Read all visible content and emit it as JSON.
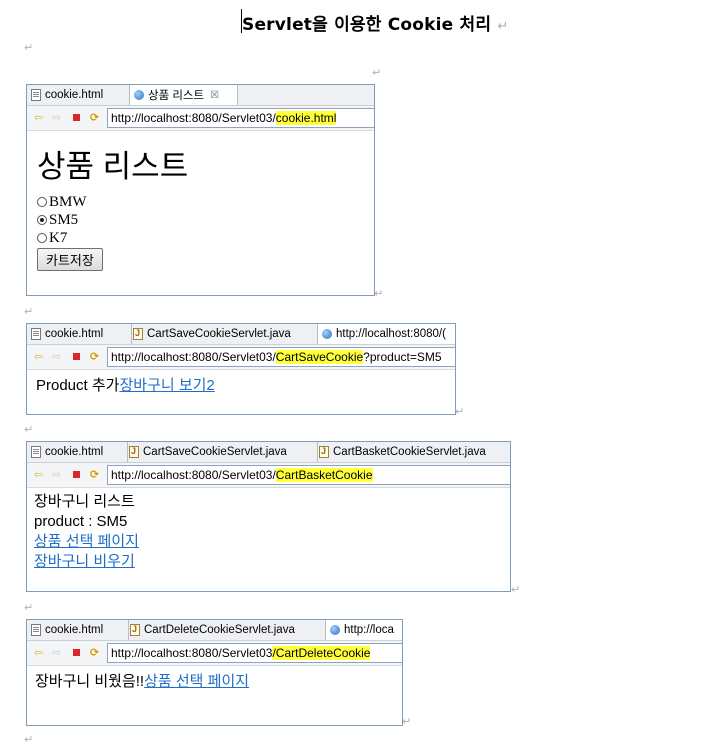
{
  "document": {
    "title": "Servlet을 이용한 Cookie 처리",
    "para_mark": "↵"
  },
  "panel1": {
    "tabs": [
      {
        "icon": "html-file-icon",
        "label": "cookie.html"
      },
      {
        "icon": "globe-icon",
        "label": "상품 리스트",
        "close": "☒"
      }
    ],
    "url_base": "http://localhost:8080/Servlet03/",
    "url_highlight": "cookie.html",
    "heading": "상품 리스트",
    "options": [
      {
        "label": "BMW",
        "checked": false
      },
      {
        "label": "SM5",
        "checked": true
      },
      {
        "label": "K7",
        "checked": false
      }
    ],
    "button": "카트저장"
  },
  "panel2": {
    "tabs": [
      {
        "icon": "html-file-icon",
        "label": "cookie.html"
      },
      {
        "icon": "java-file-icon",
        "label": "CartSaveCookieServlet.java"
      },
      {
        "icon": "globe-icon",
        "label": "http://localhost:8080/("
      }
    ],
    "url_base": "http://localhost:8080/Servlet03/",
    "url_highlight": "CartSaveCookie",
    "url_rest": "?product=SM5",
    "text": "Product 추가",
    "link": "장바구니 보기2"
  },
  "panel3": {
    "tabs": [
      {
        "icon": "html-file-icon",
        "label": "cookie.html"
      },
      {
        "icon": "java-file-icon",
        "label": "CartSaveCookieServlet.java"
      },
      {
        "icon": "java-file-icon",
        "label": "CartBasketCookieServlet.java"
      }
    ],
    "url_base": "http://localhost:8080/Servlet03/",
    "url_highlight": "CartBasketCookie",
    "line1": "장바구니 리스트",
    "line2": "product : SM5",
    "link1": "상품 선택 페이지",
    "link2": "장바구니 비우기"
  },
  "panel4": {
    "tabs": [
      {
        "icon": "html-file-icon",
        "label": "cookie.html"
      },
      {
        "icon": "java-file-icon",
        "label": "CartDeleteCookieServlet.java"
      },
      {
        "icon": "globe-icon",
        "label": "http://loca"
      }
    ],
    "url_base": "http://localhost:8080/Servlet03",
    "url_highlight": "/CartDeleteCookie",
    "text": "장바구니 비웠음!!",
    "link": "상품 선택 페이지"
  },
  "nav_icons": [
    "back-arrow-icon",
    "forward-arrow-icon",
    "stop-icon",
    "refresh-icon"
  ],
  "colors": {
    "highlight": "#ffff3c",
    "link": "#1f6fc8",
    "stop": "#d8262b",
    "frame": "#7f9db9"
  }
}
